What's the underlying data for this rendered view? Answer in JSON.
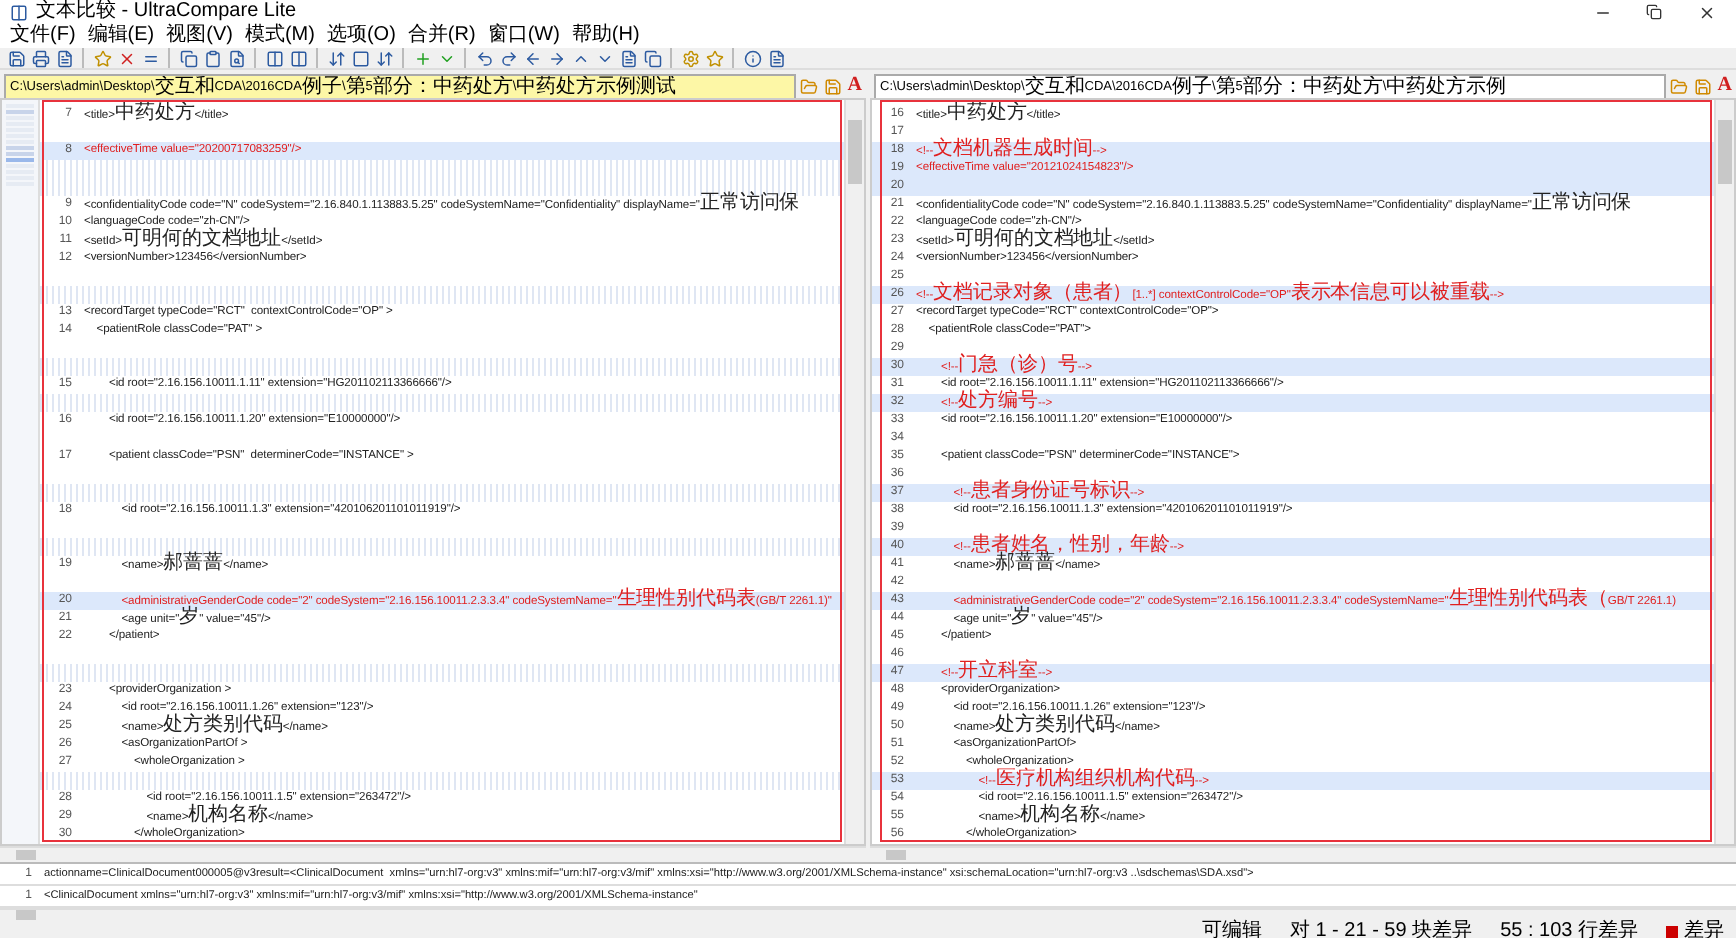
{
  "window": {
    "title": "文本比较 - UltraCompare Lite"
  },
  "menu": [
    "文件(F)",
    "编辑(E)",
    "视图(V)",
    "模式(M)",
    "选项(O)",
    "合并(R)",
    "窗口(W)",
    "帮助(H)"
  ],
  "panes": [
    {
      "path": "C:\\Users\\admin\\Desktop\\交互和CDA\\2016CDA例子\\第5部分：中药处方\\中药处方示例测试",
      "active": true,
      "font_label": "A",
      "rows": [
        {
          "kind": "line",
          "number": "7",
          "text": "<title>中药处方</title>",
          "changed": false
        },
        {
          "kind": "blank",
          "changed": false
        },
        {
          "kind": "line",
          "number": "8",
          "text": "<effectiveTime value=\"20200717083259\"/>",
          "changed": true
        },
        {
          "kind": "gap",
          "changed": false
        },
        {
          "kind": "gap",
          "changed": false
        },
        {
          "kind": "line",
          "number": "9",
          "text": "<confidentialityCode code=\"N\" codeSystem=\"2.16.840.1.113883.5.25\" codeSystemName=\"Confidentiality\" displayName=\"正常访问保",
          "changed": false
        },
        {
          "kind": "line",
          "number": "10",
          "text": "<languageCode code=\"zh-CN\"/>",
          "changed": false
        },
        {
          "kind": "line",
          "number": "11",
          "text": "<setId>可明何的文档地址</setId>",
          "changed": false
        },
        {
          "kind": "line",
          "number": "12",
          "text": "<versionNumber>123456</versionNumber>",
          "changed": false
        },
        {
          "kind": "blank",
          "changed": false
        },
        {
          "kind": "gap",
          "changed": false
        },
        {
          "kind": "line",
          "number": "13",
          "text": "<recordTarget typeCode=\"RCT\"  contextControlCode=\"OP\" >",
          "changed": false
        },
        {
          "kind": "line",
          "number": "14",
          "text": "    <patientRole classCode=\"PAT\" >",
          "changed": false
        },
        {
          "kind": "blank",
          "changed": false
        },
        {
          "kind": "gap",
          "changed": false
        },
        {
          "kind": "line",
          "number": "15",
          "text": "        <id root=\"2.16.156.10011.1.11\" extension=\"HG201102113366666\"/>",
          "changed": false
        },
        {
          "kind": "gap",
          "changed": false
        },
        {
          "kind": "line",
          "number": "16",
          "text": "        <id root=\"2.16.156.10011.1.20\" extension=\"E10000000\"/>",
          "changed": false
        },
        {
          "kind": "blank",
          "changed": false
        },
        {
          "kind": "line",
          "number": "17",
          "text": "        <patient classCode=\"PSN\"  determinerCode=\"INSTANCE\" >",
          "changed": false
        },
        {
          "kind": "blank",
          "changed": false
        },
        {
          "kind": "gap",
          "changed": false
        },
        {
          "kind": "line",
          "number": "18",
          "text": "            <id root=\"2.16.156.10011.1.3\" extension=\"420106201101011919\"/>",
          "changed": false
        },
        {
          "kind": "blank",
          "changed": false
        },
        {
          "kind": "gap",
          "changed": false
        },
        {
          "kind": "line",
          "number": "19",
          "text": "            <name>郝蔷蔷</name>",
          "changed": false
        },
        {
          "kind": "blank",
          "changed": false
        },
        {
          "kind": "line",
          "number": "20",
          "text": "            <administrativeGenderCode code=\"2\" codeSystem=\"2.16.156.10011.2.3.3.4\" codeSystemName=\"生理性别代码表(GB/T 2261.1)\"",
          "changed": true
        },
        {
          "kind": "line",
          "number": "21",
          "text": "            <age unit=\"岁\" value=\"45\"/>",
          "changed": false
        },
        {
          "kind": "line",
          "number": "22",
          "text": "        </patient>",
          "changed": false
        },
        {
          "kind": "blank",
          "changed": false
        },
        {
          "kind": "gap",
          "changed": false
        },
        {
          "kind": "line",
          "number": "23",
          "text": "        <providerOrganization >",
          "changed": false
        },
        {
          "kind": "line",
          "number": "24",
          "text": "            <id root=\"2.16.156.10011.1.26\" extension=\"123\"/>",
          "changed": false
        },
        {
          "kind": "line",
          "number": "25",
          "text": "            <name>处方类别代码</name>",
          "changed": false
        },
        {
          "kind": "line",
          "number": "26",
          "text": "            <asOrganizationPartOf >",
          "changed": false
        },
        {
          "kind": "line",
          "number": "27",
          "text": "                <wholeOrganization >",
          "changed": false
        },
        {
          "kind": "gap",
          "changed": false
        },
        {
          "kind": "line",
          "number": "28",
          "text": "                    <id root=\"2.16.156.10011.1.5\" extension=\"263472\"/>",
          "changed": false
        },
        {
          "kind": "line",
          "number": "29",
          "text": "                    <name>机构名称</name>",
          "changed": false
        },
        {
          "kind": "line",
          "number": "30",
          "text": "                </wholeOrganization>",
          "changed": false
        }
      ]
    },
    {
      "path": "C:\\Users\\admin\\Desktop\\交互和CDA\\2016CDA例子\\第5部分：中药处方\\中药处方示例",
      "active": false,
      "font_label": "A",
      "rows": [
        {
          "kind": "line",
          "number": "16",
          "text": "<title>中药处方</title>",
          "changed": false
        },
        {
          "kind": "line",
          "number": "17",
          "text": "",
          "changed": false
        },
        {
          "kind": "line",
          "number": "18",
          "text": "<!--文档机器生成时间-->",
          "changed": true
        },
        {
          "kind": "line",
          "number": "19",
          "text": "<effectiveTime value=\"20121024154823\"/>",
          "changed": true
        },
        {
          "kind": "line",
          "number": "20",
          "text": "",
          "changed": true
        },
        {
          "kind": "line",
          "number": "21",
          "text": "<confidentialityCode code=\"N\" codeSystem=\"2.16.840.1.113883.5.25\" codeSystemName=\"Confidentiality\" displayName=\"正常访问保",
          "changed": false
        },
        {
          "kind": "line",
          "number": "22",
          "text": "<languageCode code=\"zh-CN\"/>",
          "changed": false
        },
        {
          "kind": "line",
          "number": "23",
          "text": "<setId>可明何的文档地址</setId>",
          "changed": false
        },
        {
          "kind": "line",
          "number": "24",
          "text": "<versionNumber>123456</versionNumber>",
          "changed": false
        },
        {
          "kind": "line",
          "number": "25",
          "text": "",
          "changed": false
        },
        {
          "kind": "line",
          "number": "26",
          "text": "<!--文档记录对象（患者）[1..*] contextControlCode=\"OP\"表示本信息可以被重载-->",
          "changed": true
        },
        {
          "kind": "line",
          "number": "27",
          "text": "<recordTarget typeCode=\"RCT\" contextControlCode=\"OP\">",
          "changed": false
        },
        {
          "kind": "line",
          "number": "28",
          "text": "    <patientRole classCode=\"PAT\">",
          "changed": false
        },
        {
          "kind": "line",
          "number": "29",
          "text": "",
          "changed": false
        },
        {
          "kind": "line",
          "number": "30",
          "text": "        <!--门急（诊）号-->",
          "changed": true
        },
        {
          "kind": "line",
          "number": "31",
          "text": "        <id root=\"2.16.156.10011.1.11\" extension=\"HG201102113366666\"/>",
          "changed": false
        },
        {
          "kind": "line",
          "number": "32",
          "text": "        <!--处方编号-->",
          "changed": true
        },
        {
          "kind": "line",
          "number": "33",
          "text": "        <id root=\"2.16.156.10011.1.20\" extension=\"E10000000\"/>",
          "changed": false
        },
        {
          "kind": "line",
          "number": "34",
          "text": "",
          "changed": false
        },
        {
          "kind": "line",
          "number": "35",
          "text": "        <patient classCode=\"PSN\" determinerCode=\"INSTANCE\">",
          "changed": false
        },
        {
          "kind": "line",
          "number": "36",
          "text": "",
          "changed": false
        },
        {
          "kind": "line",
          "number": "37",
          "text": "            <!--患者身份证号标识-->",
          "changed": true
        },
        {
          "kind": "line",
          "number": "38",
          "text": "            <id root=\"2.16.156.10011.1.3\" extension=\"420106201101011919\"/>",
          "changed": false
        },
        {
          "kind": "line",
          "number": "39",
          "text": "",
          "changed": false
        },
        {
          "kind": "line",
          "number": "40",
          "text": "            <!--患者姓名，性别，年龄-->",
          "changed": true
        },
        {
          "kind": "line",
          "number": "41",
          "text": "            <name>郝蔷蔷</name>",
          "changed": false
        },
        {
          "kind": "line",
          "number": "42",
          "text": "",
          "changed": false
        },
        {
          "kind": "line",
          "number": "43",
          "text": "            <administrativeGenderCode code=\"2\" codeSystem=\"2.16.156.10011.2.3.3.4\" codeSystemName=\"生理性别代码表（GB/T 2261.1)",
          "changed": true
        },
        {
          "kind": "line",
          "number": "44",
          "text": "            <age unit=\"岁\" value=\"45\"/>",
          "changed": false
        },
        {
          "kind": "line",
          "number": "45",
          "text": "        </patient>",
          "changed": false
        },
        {
          "kind": "line",
          "number": "46",
          "text": "",
          "changed": false
        },
        {
          "kind": "line",
          "number": "47",
          "text": "        <!--开立科室-->",
          "changed": true
        },
        {
          "kind": "line",
          "number": "48",
          "text": "        <providerOrganization>",
          "changed": false
        },
        {
          "kind": "line",
          "number": "49",
          "text": "            <id root=\"2.16.156.10011.1.26\" extension=\"123\"/>",
          "changed": false
        },
        {
          "kind": "line",
          "number": "50",
          "text": "            <name>处方类别代码</name>",
          "changed": false
        },
        {
          "kind": "line",
          "number": "51",
          "text": "            <asOrganizationPartOf>",
          "changed": false
        },
        {
          "kind": "line",
          "number": "52",
          "text": "                <wholeOrganization>",
          "changed": false
        },
        {
          "kind": "line",
          "number": "53",
          "text": "                    <!--医疗机构组织机构代码-->",
          "changed": true
        },
        {
          "kind": "line",
          "number": "54",
          "text": "                    <id root=\"2.16.156.10011.1.5\" extension=\"263472\"/>",
          "changed": false
        },
        {
          "kind": "line",
          "number": "55",
          "text": "                    <name>机构名称</name>",
          "changed": false
        },
        {
          "kind": "line",
          "number": "56",
          "text": "                </wholeOrganization>",
          "changed": false
        }
      ]
    }
  ],
  "output_lines": [
    {
      "number": "1",
      "text": "actionname=ClinicalDocument000005@v3result=<ClinicalDocument  xmlns=\"urn:hl7-org:v3\" xmlns:mif=\"urn:hl7-org:v3/mif\" xmlns:xsi=\"http://www.w3.org/2001/XMLSchema-instance\" xsi:schemaLocation=\"urn:hl7-org:v3 ..\\sdschemas\\SDA.xsd\">"
    },
    {
      "number": "1",
      "text": "<ClinicalDocument xmlns=\"urn:hl7-org:v3\" xmlns:mif=\"urn:hl7-org:v3/mif\" xmlns:xsi=\"http://www.w3.org/2001/XMLSchema-instance\""
    }
  ],
  "status_bar": [
    "可编辑",
    "对 1 - 21 - 59 块差异",
    "55 : 103 行差异",
    "差异"
  ]
}
